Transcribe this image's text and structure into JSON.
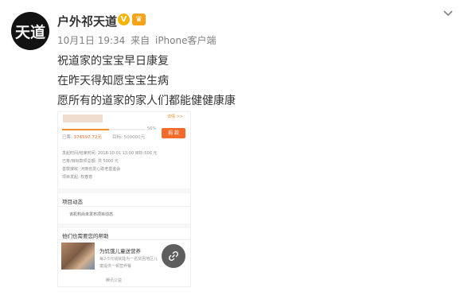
{
  "post": {
    "author": {
      "name": "户外祁天道",
      "avatar_glyph": "天道"
    },
    "meta": {
      "date": "10月1日 19:34",
      "via": "来自",
      "client": "iPhone客户端"
    },
    "text_lines": [
      "祝道家的宝宝早日康复",
      "在昨天得知愿宝宝生病",
      "愿所有的道家的家人们都能健健康康"
    ]
  },
  "screenshot": {
    "detail_link": "详情 >>",
    "progress": {
      "fraction": 0.56,
      "percent_label": "56%"
    },
    "raised_label": "已筹:",
    "raised_amount": "374597.72元",
    "target_label": "目标:",
    "target_amount": "500000元",
    "donate_button": "捐 款",
    "info": [
      "发起时间/结束时间:  2018-10-01 13:00  目标:500 元",
      "已筹/目标款项总额:  共 5000 元",
      "善款接收:  河南省爱心助老基金会",
      "项目发起:  权春意"
    ],
    "section_dynamics": {
      "title": "项目动态",
      "item": "该机构尚未发布项目动态"
    },
    "section_help": {
      "title": "他们也需要您的帮助",
      "project_title": "为饥饿儿童送营养",
      "project_desc": "每2-5元钱就能为一名贫困地区儿童提供一顿营养餐",
      "footer": "腾讯公益"
    }
  },
  "colors": {
    "accent": "#f26b2b",
    "verified": "#f7b500",
    "meta": "#808080"
  }
}
